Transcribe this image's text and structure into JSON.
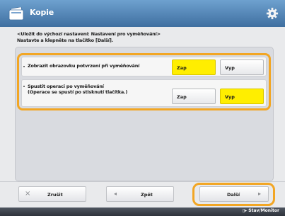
{
  "header": {
    "title": "Kopie",
    "app_icon": "copy-icon",
    "settings_icon": "gear-icon"
  },
  "info": {
    "line1": "<Uložit do výchozí nastavení: Nastavení pro vyměňování>",
    "line2": "Nastavte a klepněte na tlačítko [Další]."
  },
  "settings": [
    {
      "label": "Zobrazit obrazovku potvrzení při vyměňování",
      "options": [
        {
          "label": "Zap",
          "selected": true
        },
        {
          "label": "Vyp",
          "selected": false
        }
      ]
    },
    {
      "label_line1": "Spustit operaci po vyměňování",
      "label_line2": "(Operace se spustí po stisknutí tlačítka.)",
      "options": [
        {
          "label": "Zap",
          "selected": false
        },
        {
          "label": "Vyp",
          "selected": true
        }
      ]
    }
  ],
  "footer": {
    "cancel_label": "Zrušit",
    "back_label": "Zpět",
    "next_label": "Další"
  },
  "statusbar": {
    "monitor_label": "Stav/Monitor"
  },
  "colors": {
    "header": "#3f6fa0",
    "accent": "#f2a624",
    "selected": "#ffee00"
  }
}
